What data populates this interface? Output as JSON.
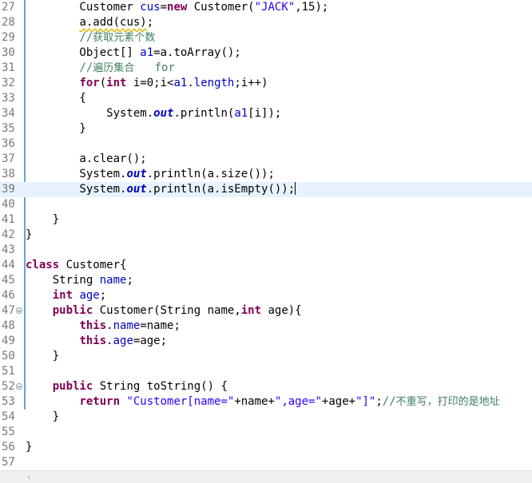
{
  "editor": {
    "lines": [
      {
        "n": "27",
        "tokens": [
          [
            "",
            "        Customer "
          ],
          [
            "fld",
            "cus"
          ],
          [
            "",
            "="
          ],
          [
            "kw",
            "new"
          ],
          [
            "",
            " Customer("
          ],
          [
            "str",
            "\"JACK\""
          ],
          [
            "",
            ",15);"
          ]
        ]
      },
      {
        "n": "28",
        "tokens": [
          [
            "",
            "        "
          ],
          [
            "warn",
            "a.add(cus)"
          ],
          [
            "",
            ";"
          ]
        ]
      },
      {
        "n": "29",
        "tokens": [
          [
            "",
            "        "
          ],
          [
            "cmt",
            "//"
          ],
          [
            "cmt cjk",
            "获取元素个数"
          ]
        ]
      },
      {
        "n": "30",
        "tokens": [
          [
            "",
            "        Object[] "
          ],
          [
            "fld",
            "a1"
          ],
          [
            "",
            "=a.toArray();"
          ]
        ]
      },
      {
        "n": "31",
        "tokens": [
          [
            "",
            "        "
          ],
          [
            "cmt",
            "//"
          ],
          [
            "cmt cjk",
            "遍历集合"
          ],
          [
            "cmt",
            "   for"
          ]
        ]
      },
      {
        "n": "32",
        "tokens": [
          [
            "",
            "        "
          ],
          [
            "kw",
            "for"
          ],
          [
            "",
            "("
          ],
          [
            "kw",
            "int"
          ],
          [
            "",
            " i=0;i<"
          ],
          [
            "fld",
            "a1"
          ],
          [
            "",
            "."
          ],
          [
            "fld",
            "length"
          ],
          [
            "",
            ";i++)"
          ]
        ]
      },
      {
        "n": "33",
        "tokens": [
          [
            "",
            "        {"
          ]
        ]
      },
      {
        "n": "34",
        "tokens": [
          [
            "",
            "            System."
          ],
          [
            "sfld",
            "out"
          ],
          [
            "",
            ".println("
          ],
          [
            "fld",
            "a1"
          ],
          [
            "",
            "[i]);"
          ]
        ]
      },
      {
        "n": "35",
        "tokens": [
          [
            "",
            "        }"
          ]
        ]
      },
      {
        "n": "36",
        "tokens": []
      },
      {
        "n": "37",
        "tokens": [
          [
            "",
            "        a.clear();"
          ]
        ]
      },
      {
        "n": "38",
        "tokens": [
          [
            "",
            "        System."
          ],
          [
            "sfld",
            "out"
          ],
          [
            "",
            ".println(a.size());"
          ]
        ]
      },
      {
        "n": "39",
        "current": true,
        "caret": true,
        "tokens": [
          [
            "",
            "        System."
          ],
          [
            "sfld",
            "out"
          ],
          [
            "",
            ".println(a.isEmpty());"
          ]
        ]
      },
      {
        "n": "40",
        "tokens": []
      },
      {
        "n": "41",
        "tokens": [
          [
            "",
            "    }"
          ]
        ]
      },
      {
        "n": "42",
        "tokens": [
          [
            "",
            "}"
          ]
        ]
      },
      {
        "n": "43",
        "tokens": []
      },
      {
        "n": "44",
        "tokens": [
          [
            "kw",
            "class"
          ],
          [
            "",
            " Customer{"
          ]
        ]
      },
      {
        "n": "45",
        "tokens": [
          [
            "",
            "    String "
          ],
          [
            "fld",
            "name"
          ],
          [
            "",
            ";"
          ]
        ]
      },
      {
        "n": "46",
        "tokens": [
          [
            "",
            "    "
          ],
          [
            "kw",
            "int"
          ],
          [
            "",
            " "
          ],
          [
            "fld",
            "age"
          ],
          [
            "",
            ";"
          ]
        ]
      },
      {
        "n": "47",
        "fold": true,
        "tokens": [
          [
            "",
            "    "
          ],
          [
            "kw",
            "public"
          ],
          [
            "",
            " Customer(String name,"
          ],
          [
            "kw",
            "int"
          ],
          [
            "",
            " age){"
          ]
        ]
      },
      {
        "n": "48",
        "tokens": [
          [
            "",
            "        "
          ],
          [
            "kw",
            "this"
          ],
          [
            "",
            "."
          ],
          [
            "fld",
            "name"
          ],
          [
            "",
            "=name;"
          ]
        ]
      },
      {
        "n": "49",
        "tokens": [
          [
            "",
            "        "
          ],
          [
            "kw",
            "this"
          ],
          [
            "",
            "."
          ],
          [
            "fld",
            "age"
          ],
          [
            "",
            "=age;"
          ]
        ]
      },
      {
        "n": "50",
        "tokens": [
          [
            "",
            "    }"
          ]
        ]
      },
      {
        "n": "51",
        "tokens": []
      },
      {
        "n": "52",
        "fold": true,
        "tokens": [
          [
            "",
            "    "
          ],
          [
            "kw",
            "public"
          ],
          [
            "",
            " String toString() {"
          ]
        ]
      },
      {
        "n": "53",
        "tokens": [
          [
            "",
            "        "
          ],
          [
            "kw",
            "return"
          ],
          [
            "",
            " "
          ],
          [
            "str",
            "\"Customer[name=\""
          ],
          [
            "",
            "+name+"
          ],
          [
            "str",
            "\",age=\""
          ],
          [
            "",
            "+age+"
          ],
          [
            "str",
            "\"]\""
          ],
          [
            "",
            ";"
          ],
          [
            "cmt",
            "//"
          ],
          [
            "cmt cjk",
            "不重写，打印的是地址"
          ]
        ]
      },
      {
        "n": "54",
        "tokens": [
          [
            "",
            "    }"
          ]
        ]
      },
      {
        "n": "55",
        "tokens": []
      },
      {
        "n": "56",
        "tokens": [
          [
            "",
            "}"
          ]
        ]
      },
      {
        "n": "57",
        "tokens": []
      }
    ]
  },
  "scrollbar": {
    "left_arrow": "‹"
  },
  "colors": {
    "keyword": "#7f0055",
    "field": "#0000c0",
    "string": "#2a00ff",
    "comment": "#3f7f5f",
    "current_line": "#e8f2fe",
    "line_number": "#787878"
  }
}
